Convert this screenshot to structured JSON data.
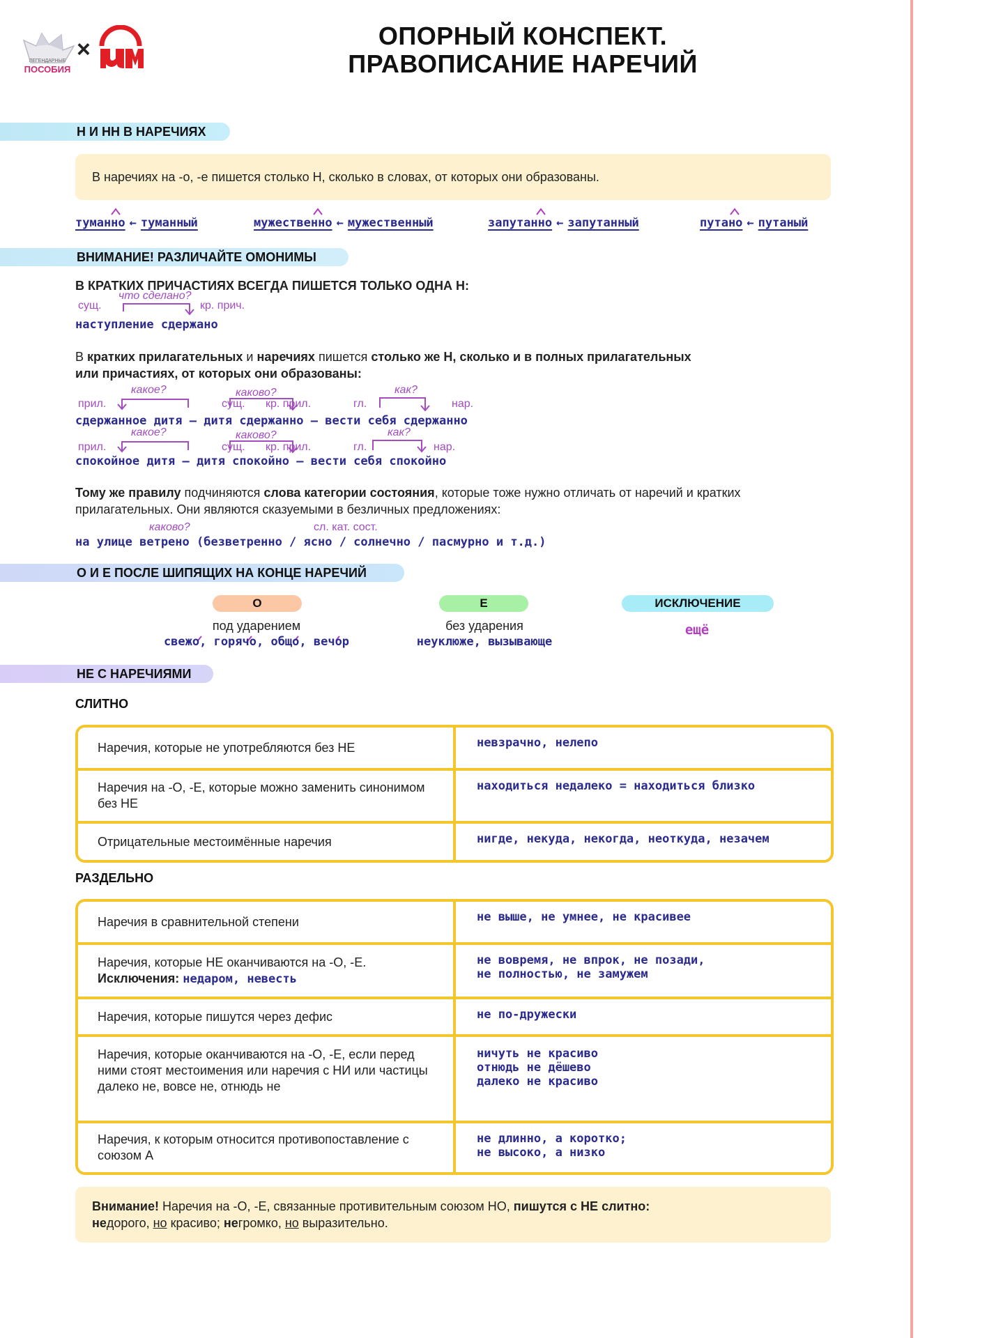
{
  "header": {
    "logo_text": "ПОСОБИЯ",
    "logo_small_text": "ЛЕГЕНДАРНЫЕ",
    "cross": "×",
    "title_line1": "ОПОРНЫЙ КОНСПЕКТ.",
    "title_line2": "ПРАВОПИСАНИЕ НАРЕЧИЙ"
  },
  "section1": {
    "heading": "Н И НН В НАРЕЧИЯХ",
    "rule": "В наречиях на -о, -е пишется столько Н, сколько в словах, от которых они образованы.",
    "pairs": [
      {
        "adv": "туманно",
        "arrow": "←",
        "adj": "туманный"
      },
      {
        "adv": "мужественно",
        "arrow": "←",
        "adj": "мужественный"
      },
      {
        "adv": "запутанно",
        "arrow": "←",
        "adj": "запутанный"
      },
      {
        "adv": "путано",
        "arrow": "←",
        "adj": "путаный"
      }
    ]
  },
  "section2": {
    "heading": "ВНИМАНИЕ! РАЗЛИЧАЙТЕ ОМОНИМЫ",
    "short_participles_rule": "В КРАТКИХ ПРИЧАСТИЯХ ВСЕГДА ПИШЕТСЯ ТОЛЬКО ОДНА Н:",
    "ex1": {
      "label_noun": "сущ.",
      "question": "что сделано?",
      "label_part": "кр. прич.",
      "text": "наступление сдержано"
    },
    "rule2_parts": {
      "p1": "В ",
      "b1": "кратких прилагательных",
      "p2": " и ",
      "b2": "наречиях",
      "p3": " пишется ",
      "b3": "столько же Н, сколько и в полных прилагательных",
      "b4": "или причастиях, от которых они образованы:"
    },
    "ex2": {
      "q1": "какое?",
      "q2": "каково?",
      "q3": "как?",
      "l_adj": "прил.",
      "l_noun": "сущ.",
      "l_short": "кр. прил.",
      "l_verb": "гл.",
      "l_adv": "нар.",
      "text": "сдержанное дитя — дитя сдержанно — вести себя сдержанно"
    },
    "ex3": {
      "q1": "какое?",
      "q2": "каково?",
      "q3": "как?",
      "l_adj": "прил.",
      "l_noun": "сущ.",
      "l_short": "кр. прил.",
      "l_verb": "гл.",
      "l_adv": "нар.",
      "text": "спокойное дитя — дитя спокойно — вести себя спокойно"
    },
    "rule3_parts": {
      "b1": "Тому же правилу",
      "p1": " подчиняются ",
      "b2": "слова категории состояния",
      "p2": ", которые тоже нужно отличать от наречий и кратких",
      "p3": "прилагательных. Они являются сказуемыми в безличных предложениях:"
    },
    "ex4": {
      "question": "каково?",
      "label": "сл. кат. сост.",
      "text": "на улице ветрено (безветренно / ясно / солнечно / пасмурно и т.д.)"
    }
  },
  "section3": {
    "heading": "О И Е ПОСЛЕ ШИПЯЩИХ НА КОНЦЕ НАРЕЧИЙ",
    "col_o": {
      "pill": "О",
      "desc": "под ударением",
      "examples": "свежо, горячо, общо, вечор"
    },
    "col_e": {
      "pill": "Е",
      "desc": "без ударения",
      "examples": "неуклюже, вызывающе"
    },
    "col_ex": {
      "pill": "ИСКЛЮЧЕНИЕ",
      "examples": "ещё"
    }
  },
  "section4": {
    "heading": "НЕ С НАРЕЧИЯМИ",
    "together": "СЛИТНО",
    "together_rows": [
      {
        "rule": "Наречия, которые не употребляются без НЕ",
        "ex": [
          "невзрачно, нелепо"
        ]
      },
      {
        "rule": "Наречия на -О, -Е, которые можно заменить синонимом без НЕ",
        "ex": [
          "находиться недалеко = находиться близко"
        ]
      },
      {
        "rule": "Отрицательные местоимённые наречия",
        "ex": [
          "нигде, некуда, некогда, неоткуда, незачем"
        ]
      }
    ],
    "separately": "РАЗДЕЛЬНО",
    "separate_rows": [
      {
        "rule": "Наречия в сравнительной степени",
        "ex": [
          "не выше, не умнее, не красивее"
        ]
      },
      {
        "rule": "Наречия, которые НЕ оканчиваются на -О, -Е.",
        "exception_label": "Исключения:",
        "exception_value": "недаром, невесть",
        "ex": [
          "не вовремя, не впрок, не позади,",
          "не полностью, не замужем"
        ]
      },
      {
        "rule": "Наречия, которые пишутся через дефис",
        "ex": [
          "не по-дружески"
        ]
      },
      {
        "rule": "Наречия, которые оканчиваются на -О, -Е, если перед ними стоят местоимения или наречия с НИ или частицы далеко не, вовсе не, отнюдь не",
        "ex": [
          "ничуть не красиво",
          "отнюдь не дёшево",
          "далеко не красиво"
        ]
      },
      {
        "rule": "Наречия, к которым относится противопоставление с союзом А",
        "ex": [
          "не длинно, а коротко;",
          "не высоко, а низко"
        ]
      }
    ],
    "final_note": {
      "b1": "Внимание!",
      "p1": " Наречия на -О, -Е, связанные противительным союзом НО, ",
      "b2": "пишутся с НЕ слитно:",
      "line2_b1": "не",
      "line2_p1": "дорого, ",
      "line2_u1": "но",
      "line2_p2": " красиво; ",
      "line2_b2": "не",
      "line2_p3": "громко, ",
      "line2_u2": "но",
      "line2_p4": " выразительно."
    }
  },
  "colors": {
    "accent_blue_dark": "#2b2b8f",
    "accent_purple": "#a24cc0",
    "note_bg": "#fdf1d0",
    "table_border": "#f3c62e",
    "side_line": "#f2a7a0",
    "pill_o": "#fbc7a4",
    "pill_e": "#a8f0a6",
    "pill_exception": "#a8ecf7"
  }
}
